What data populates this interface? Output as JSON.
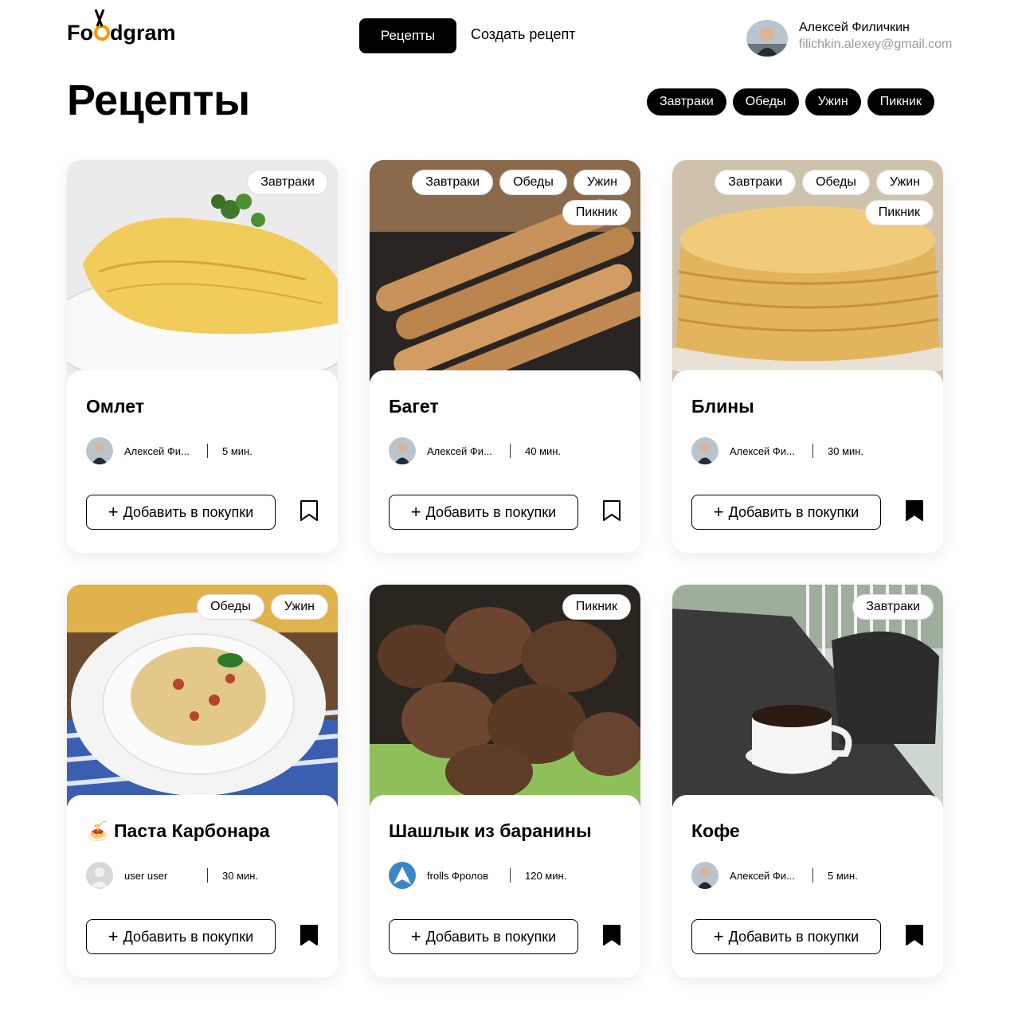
{
  "header": {
    "logo_text": "Foodgram",
    "nav_active": "Рецепты",
    "nav_create": "Создать рецепт",
    "user_name": "Алексей Филичкин",
    "user_email": "filichkin.alexey@gmail.com"
  },
  "page": {
    "title": "Рецепты",
    "filters": [
      "Завтраки",
      "Обеды",
      "Ужин",
      "Пикник"
    ]
  },
  "cards": [
    {
      "title": "Омлет",
      "tags": [
        "Завтраки"
      ],
      "author": "Алексей Фи...",
      "time": "5 мин.",
      "add_label": "Добавить в покупки",
      "bookmarked": false
    },
    {
      "title": "Багет",
      "tags": [
        "Завтраки",
        "Обеды",
        "Ужин",
        "Пикник"
      ],
      "author": "Алексей Фи...",
      "time": "40 мин.",
      "add_label": "Добавить в покупки",
      "bookmarked": false
    },
    {
      "title": "Блины",
      "tags": [
        "Завтраки",
        "Обеды",
        "Ужин",
        "Пикник"
      ],
      "author": "Алексей Фи...",
      "time": "30 мин.",
      "add_label": "Добавить в покупки",
      "bookmarked": true
    },
    {
      "title": "🍝 Паста Карбонара",
      "tags": [
        "Обеды",
        "Ужин"
      ],
      "author": "user user",
      "time": "30 мин.",
      "add_label": "Добавить в покупки",
      "bookmarked": true
    },
    {
      "title": "Шашлык из баранины",
      "tags": [
        "Пикник"
      ],
      "author": "frolls Фролов",
      "time": "120 мин.",
      "add_label": "Добавить в покупки",
      "bookmarked": true
    },
    {
      "title": "Кофе",
      "tags": [
        "Завтраки"
      ],
      "author": "Алексей Фи...",
      "time": "5 мин.",
      "add_label": "Добавить в покупки",
      "bookmarked": true
    }
  ],
  "colors": {
    "primary": "#000000",
    "accent": "#ff9500",
    "background": "#ffffff"
  }
}
